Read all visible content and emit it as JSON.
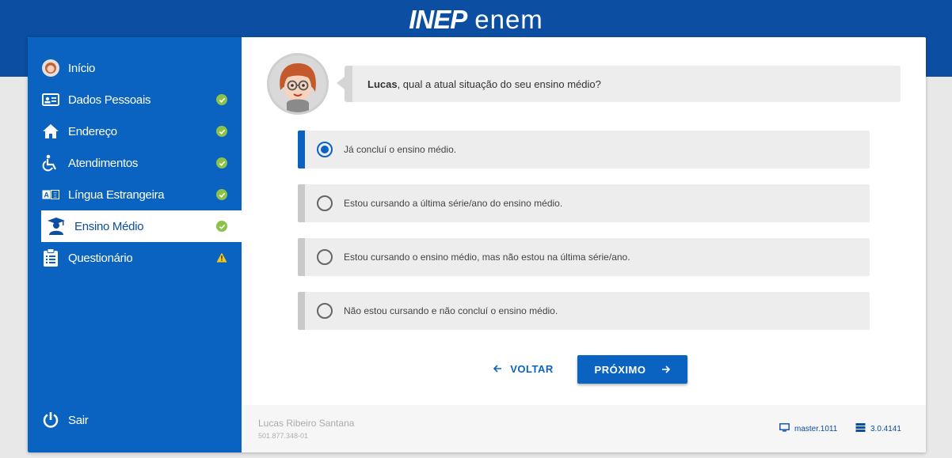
{
  "header": {
    "logo_inep": "INEP",
    "logo_enem": "enem"
  },
  "sidebar": {
    "items": [
      {
        "label": "Início",
        "icon": "user-avatar-icon",
        "status": "none"
      },
      {
        "label": "Dados Pessoais",
        "icon": "id-card-icon",
        "status": "complete"
      },
      {
        "label": "Endereço",
        "icon": "home-icon",
        "status": "complete"
      },
      {
        "label": "Atendimentos",
        "icon": "wheelchair-icon",
        "status": "complete"
      },
      {
        "label": "Língua Estrangeira",
        "icon": "translate-icon",
        "status": "complete"
      },
      {
        "label": "Ensino Médio",
        "icon": "graduate-icon",
        "status": "complete",
        "active": true
      },
      {
        "label": "Questionário",
        "icon": "clipboard-icon",
        "status": "warning"
      }
    ],
    "logout_label": "Sair"
  },
  "question": {
    "name": "Lucas",
    "text": ", qual a atual situação do seu ensino médio?"
  },
  "options": [
    {
      "label": "Já concluí o ensino médio.",
      "selected": true
    },
    {
      "label": "Estou cursando a última série/ano do ensino médio.",
      "selected": false
    },
    {
      "label": "Estou cursando o ensino médio, mas não estou na última série/ano.",
      "selected": false
    },
    {
      "label": "Não estou cursando e não concluí o ensino médio.",
      "selected": false
    }
  ],
  "buttons": {
    "back_label": "VOLTAR",
    "next_label": "PRÓXIMO"
  },
  "footer": {
    "user_name": "Lucas Ribeiro Santana",
    "user_id": "501.877.348-01",
    "branch": "master.1011",
    "version": "3.0.4141"
  },
  "colors": {
    "primary": "#0b63c1",
    "header": "#0b4ea2",
    "check": "#8bc34a",
    "warning": "#f5c518"
  }
}
